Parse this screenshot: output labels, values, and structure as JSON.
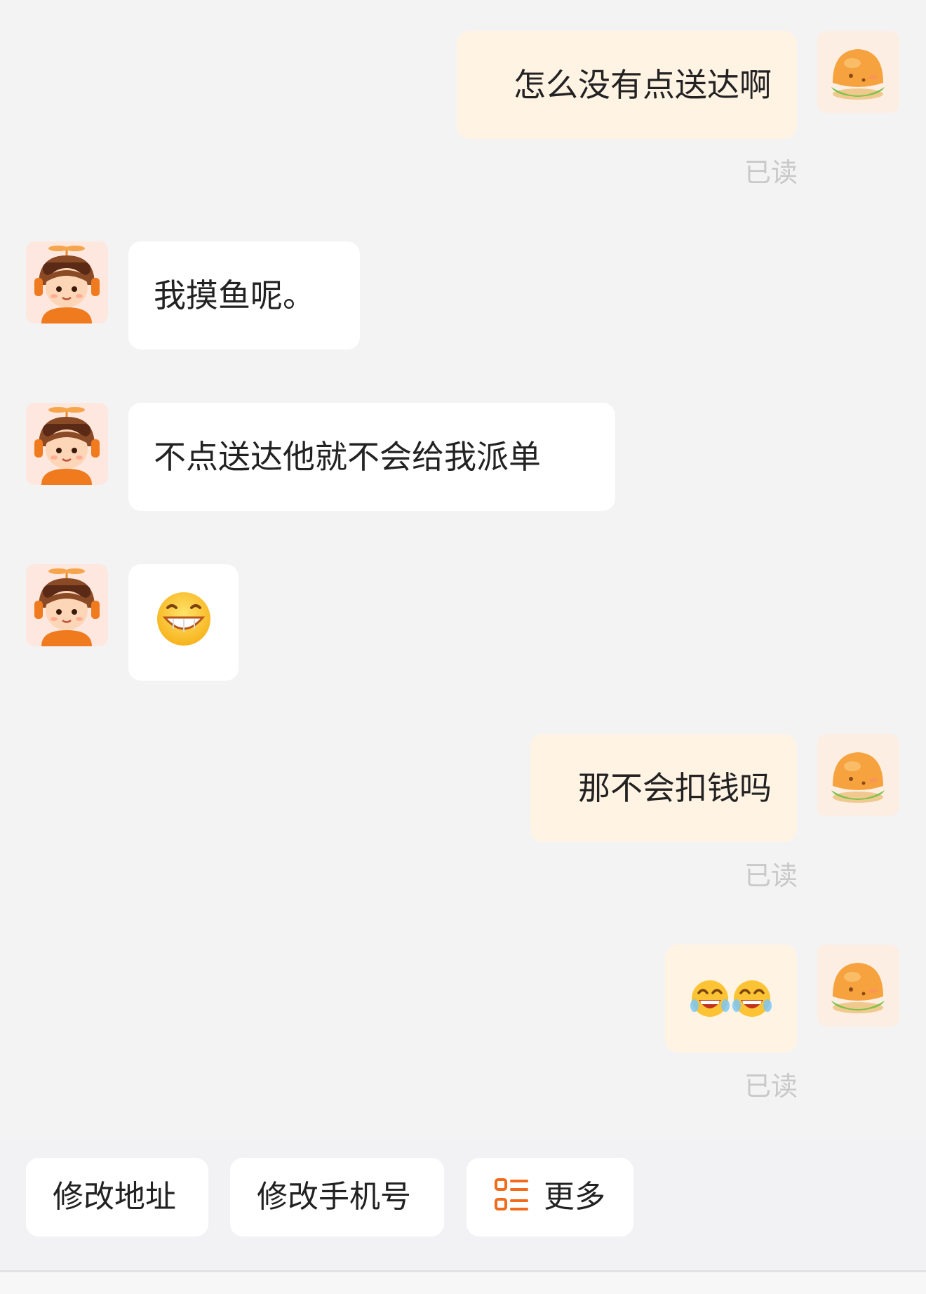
{
  "messages": [
    {
      "sender": "me",
      "type": "text",
      "text": "怎么没有点送达啊",
      "status": "已读"
    },
    {
      "sender": "rider",
      "type": "text",
      "text": "我摸鱼呢。"
    },
    {
      "sender": "rider",
      "type": "text",
      "text": "不点送达他就不会给我派单"
    },
    {
      "sender": "rider",
      "type": "emoji",
      "emoji": "grinning-face-emoji"
    },
    {
      "sender": "me",
      "type": "text",
      "text": "那不会扣钱吗",
      "status": "已读"
    },
    {
      "sender": "me",
      "type": "emoji",
      "emoji": "laughing-face-emoji x2",
      "status": "已读"
    }
  ],
  "avatars": {
    "me": "burger-avatar",
    "rider": "rider-avatar"
  },
  "quick_actions": [
    {
      "label": "修改地址"
    },
    {
      "label": "修改手机号"
    },
    {
      "label": "更多",
      "icon": "menu-list-icon"
    }
  ],
  "colors": {
    "background": "#f3f3f4",
    "my_bubble": "#fff3e4",
    "rider_bubble": "#ffffff",
    "read_text": "#c9c9c9",
    "accent": "#f26a1b"
  }
}
